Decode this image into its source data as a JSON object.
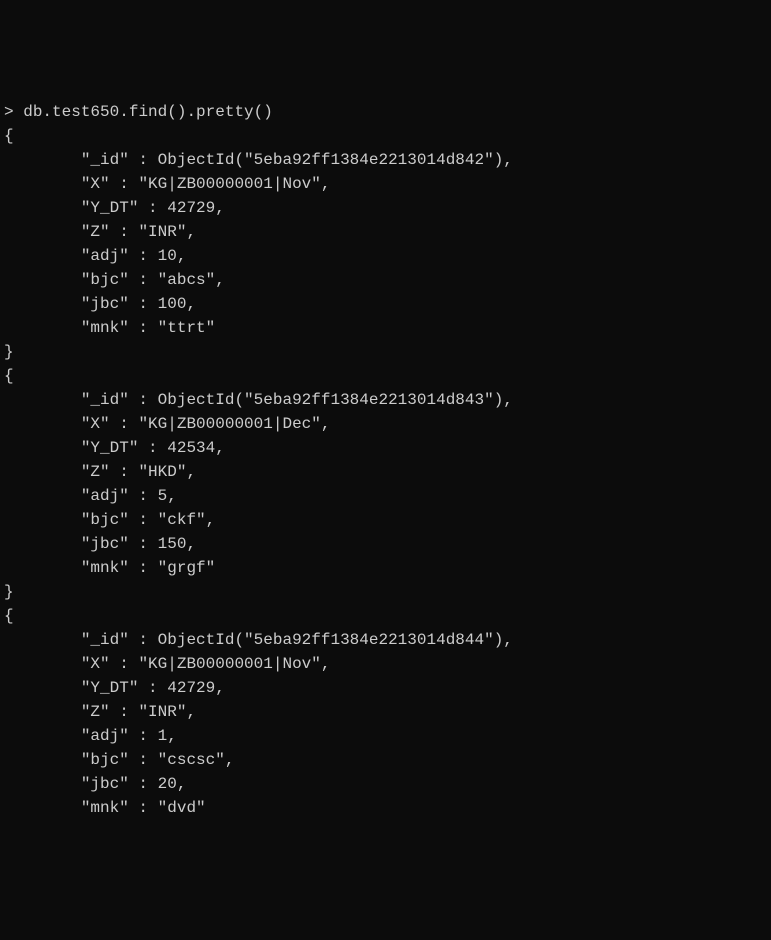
{
  "command": {
    "prompt": ">",
    "text": "db.test650.find().pretty()"
  },
  "documents": [
    {
      "_id": "ObjectId(\"5eba92ff1384e2213014d842\")",
      "X": "\"KG|ZB00000001|Nov\"",
      "Y_DT": "42729",
      "Z": "\"INR\"",
      "adj": "10",
      "bjc": "\"abcs\"",
      "jbc": "100",
      "mnk": "\"ttrt\""
    },
    {
      "_id": "ObjectId(\"5eba92ff1384e2213014d843\")",
      "X": "\"KG|ZB00000001|Dec\"",
      "Y_DT": "42534",
      "Z": "\"HKD\"",
      "adj": "5",
      "bjc": "\"ckf\"",
      "jbc": "150",
      "mnk": "\"grgf\""
    },
    {
      "_id": "ObjectId(\"5eba92ff1384e2213014d844\")",
      "X": "\"KG|ZB00000001|Nov\"",
      "Y_DT": "42729",
      "Z": "\"INR\"",
      "adj": "1",
      "bjc": "\"cscsc\"",
      "jbc": "20",
      "mnk": "\"dvd\""
    }
  ],
  "braces": {
    "open": "{",
    "close": "}"
  },
  "field_labels": {
    "_id": "\"_id\"",
    "X": "\"X\"",
    "Y_DT": "\"Y_DT\"",
    "Z": "\"Z\"",
    "adj": "\"adj\"",
    "bjc": "\"bjc\"",
    "jbc": "\"jbc\"",
    "mnk": "\"mnk\""
  },
  "sep": " : ",
  "comma": ","
}
